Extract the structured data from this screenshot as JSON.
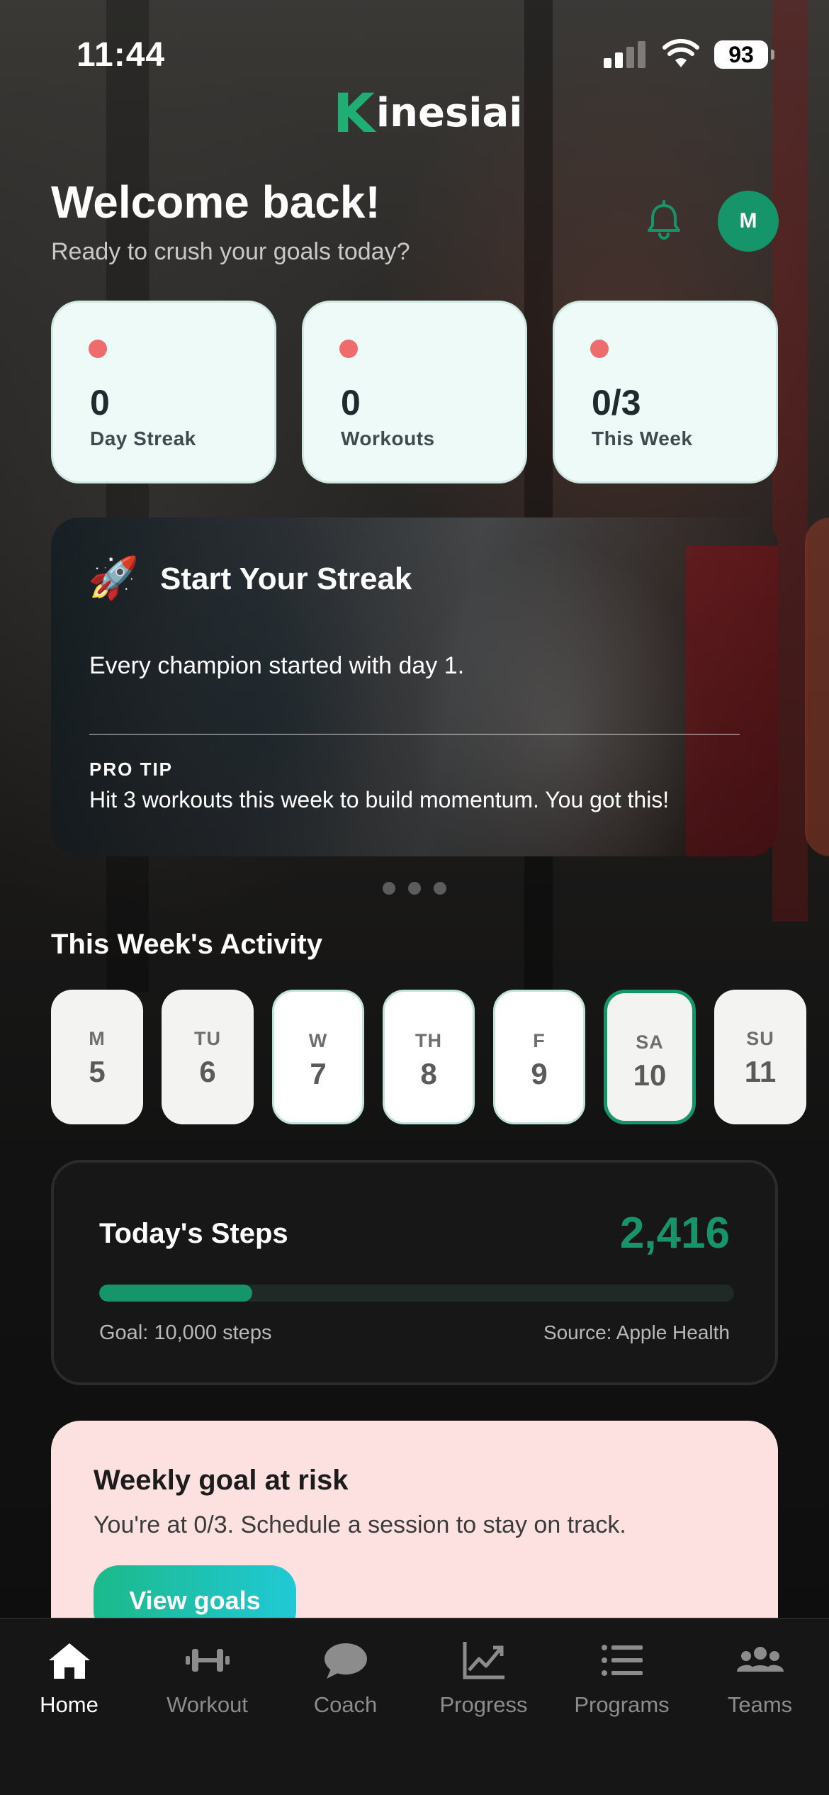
{
  "status_bar": {
    "time": "11:44",
    "battery": "93"
  },
  "brand": {
    "logo_k": "K",
    "logo_rest": "inesiai",
    "accent": "#17956a"
  },
  "header": {
    "title": "Welcome back!",
    "subtitle": "Ready to crush your goals today?",
    "avatar_initial": "M"
  },
  "stats": [
    {
      "value": "0",
      "label": "Day Streak"
    },
    {
      "value": "0",
      "label": "Workouts"
    },
    {
      "value": "0/3",
      "label": "This Week"
    }
  ],
  "hero": {
    "title": "Start Your Streak",
    "text": "Every champion started with day 1.",
    "tip_label": "PRO TIP",
    "tip": "Hit 3 workouts this week to build momentum. You got this!",
    "emoji": "🚀"
  },
  "activity": {
    "title": "This Week's Activity",
    "days": [
      {
        "label": "M",
        "num": "5",
        "state": "past"
      },
      {
        "label": "TU",
        "num": "6",
        "state": "past"
      },
      {
        "label": "W",
        "num": "7",
        "state": "upcoming"
      },
      {
        "label": "TH",
        "num": "8",
        "state": "upcoming"
      },
      {
        "label": "F",
        "num": "9",
        "state": "upcoming"
      },
      {
        "label": "SA",
        "num": "10",
        "state": "today"
      },
      {
        "label": "SU",
        "num": "11",
        "state": "past"
      }
    ]
  },
  "steps": {
    "title": "Today's Steps",
    "value": "2,416",
    "progress": 0.2416,
    "goal": "Goal: 10,000 steps",
    "source": "Source: Apple Health"
  },
  "risk": {
    "title": "Weekly goal at risk",
    "text": "You're at 0/3. Schedule a session to stay on track.",
    "button": "View goals"
  },
  "tabs": [
    {
      "label": "Home",
      "icon": "home-icon",
      "active": true
    },
    {
      "label": "Workout",
      "icon": "dumbbell-icon",
      "active": false
    },
    {
      "label": "Coach",
      "icon": "chat-bubble-icon",
      "active": false
    },
    {
      "label": "Progress",
      "icon": "chart-icon",
      "active": false
    },
    {
      "label": "Programs",
      "icon": "list-icon",
      "active": false
    },
    {
      "label": "Teams",
      "icon": "people-icon",
      "active": false
    }
  ]
}
